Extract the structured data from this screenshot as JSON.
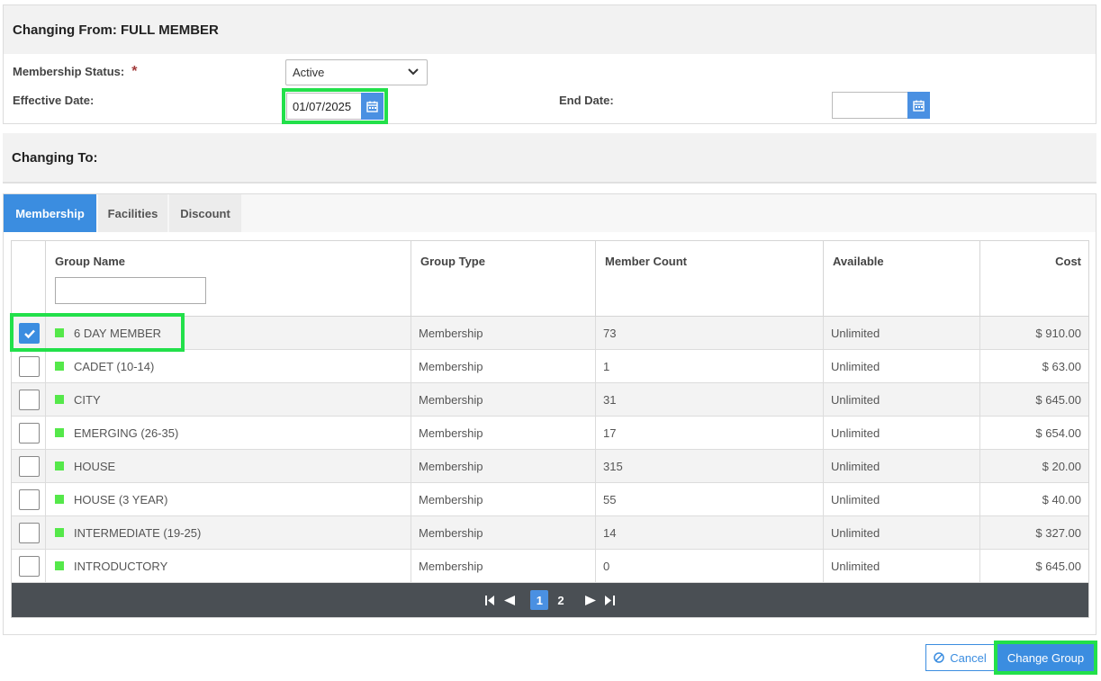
{
  "from": {
    "title": "Changing From: FULL MEMBER",
    "membership_status_label": "Membership Status:",
    "required_mark": "*",
    "membership_status_value": "Active",
    "effective_date_label": "Effective Date:",
    "effective_date_value": "01/07/2025",
    "end_date_label": "End Date:",
    "end_date_value": ""
  },
  "to": {
    "title": "Changing To:"
  },
  "tabs": [
    {
      "label": "Membership",
      "active": true
    },
    {
      "label": "Facilities",
      "active": false
    },
    {
      "label": "Discount",
      "active": false
    }
  ],
  "grid": {
    "columns": [
      "Group Name",
      "Group Type",
      "Member Count",
      "Available",
      "Cost"
    ],
    "filter_value": "",
    "rows": [
      {
        "name": "6 DAY MEMBER",
        "type": "Membership",
        "count": "73",
        "available": "Unlimited",
        "cost": "$ 910.00",
        "checked": true
      },
      {
        "name": "CADET (10-14)",
        "type": "Membership",
        "count": "1",
        "available": "Unlimited",
        "cost": "$ 63.00",
        "checked": false
      },
      {
        "name": "CITY",
        "type": "Membership",
        "count": "31",
        "available": "Unlimited",
        "cost": "$ 645.00",
        "checked": false
      },
      {
        "name": "EMERGING (26-35)",
        "type": "Membership",
        "count": "17",
        "available": "Unlimited",
        "cost": "$ 654.00",
        "checked": false
      },
      {
        "name": "HOUSE",
        "type": "Membership",
        "count": "315",
        "available": "Unlimited",
        "cost": "$ 20.00",
        "checked": false
      },
      {
        "name": "HOUSE (3 YEAR)",
        "type": "Membership",
        "count": "55",
        "available": "Unlimited",
        "cost": "$ 40.00",
        "checked": false
      },
      {
        "name": "INTERMEDIATE (19-25)",
        "type": "Membership",
        "count": "14",
        "available": "Unlimited",
        "cost": "$ 327.00",
        "checked": false
      },
      {
        "name": "INTRODUCTORY",
        "type": "Membership",
        "count": "0",
        "available": "Unlimited",
        "cost": "$ 645.00",
        "checked": false
      }
    ],
    "status_dot_color": "#55e84a"
  },
  "pager": {
    "pages": [
      "1",
      "2"
    ],
    "current": "1"
  },
  "actions": {
    "cancel_label": "Cancel",
    "change_label": "Change Group"
  },
  "colors": {
    "accent": "#3b8de0",
    "highlight": "#22e04a"
  }
}
